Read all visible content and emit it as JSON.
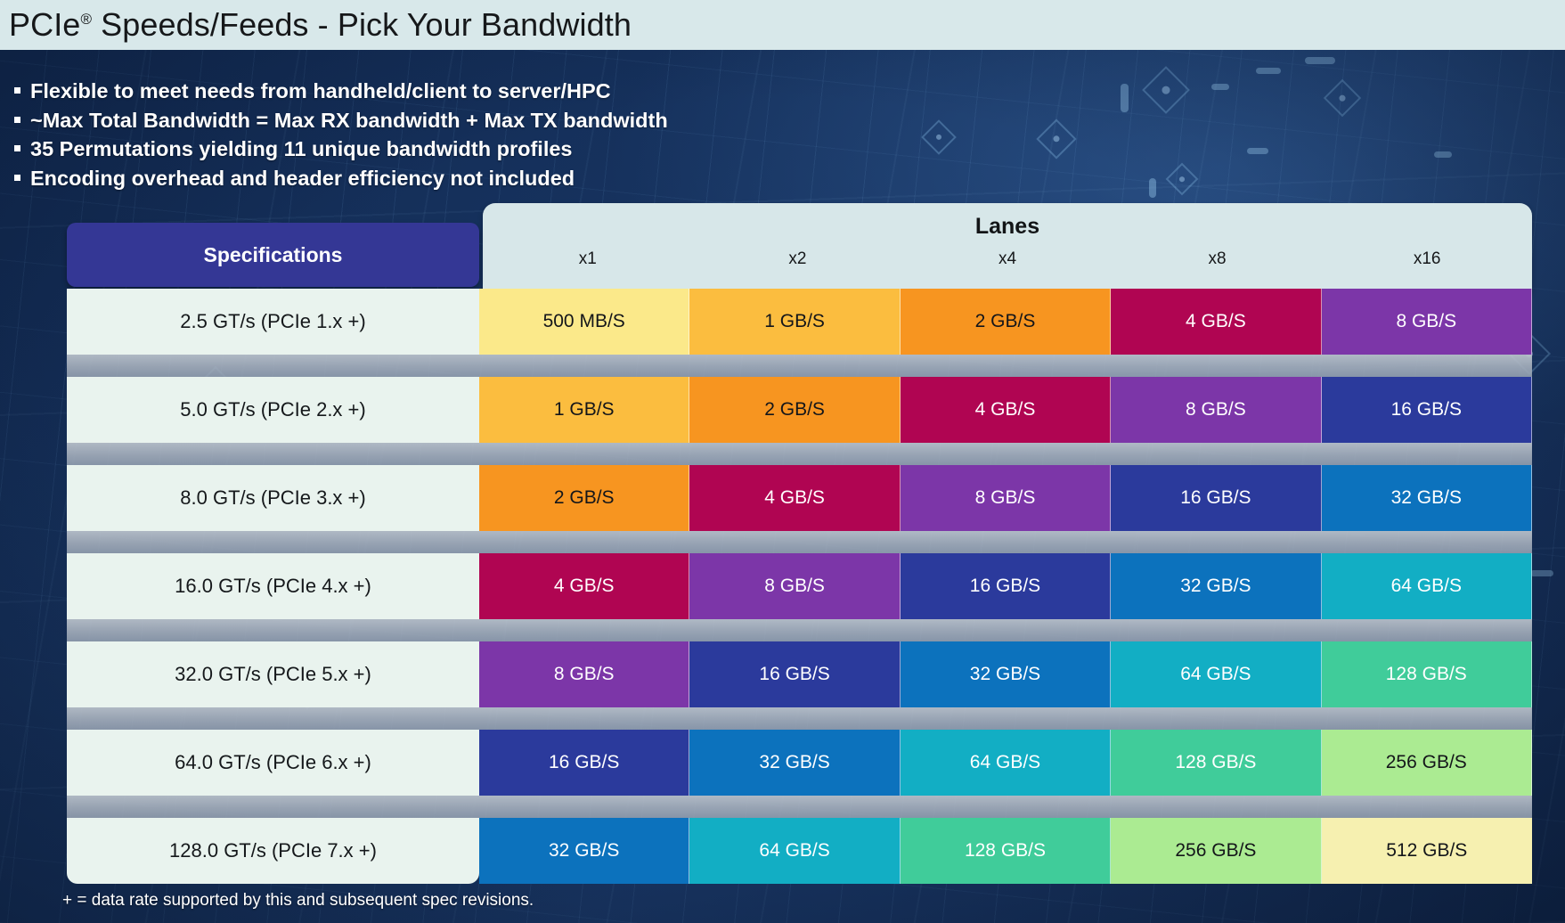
{
  "title": {
    "main": "PCIe",
    "sup": "®",
    "rest": " Speeds/Feeds - Pick Your Bandwidth",
    "full": "PCIe® Speeds/Feeds - Pick Your Bandwidth"
  },
  "bullets": [
    "Flexible to meet needs from handheld/client to server/HPC",
    "~Max Total Bandwidth = Max RX bandwidth + Max TX bandwidth",
    "35 Permutations yielding 11 unique bandwidth profiles",
    "Encoding overhead and header efficiency not included"
  ],
  "table": {
    "spec_header": "Specifications",
    "lanes_header": "Lanes",
    "lane_columns": [
      "x1",
      "x2",
      "x4",
      "x8",
      "x16"
    ],
    "rows": [
      {
        "spec": "2.5 GT/s (PCIe 1.x +)",
        "values": [
          "500 MB/S",
          "1 GB/S",
          "2 GB/S",
          "4 GB/S",
          "8 GB/S"
        ],
        "colors": [
          "#fbe98a",
          "#fbbd3f",
          "#f79520",
          "#b00552",
          "#7c36a8"
        ],
        "text_colors": [
          "dark",
          "dark",
          "dark",
          "light",
          "light"
        ]
      },
      {
        "spec": "5.0 GT/s (PCIe 2.x +)",
        "values": [
          "1 GB/S",
          "2 GB/S",
          "4 GB/S",
          "8 GB/S",
          "16 GB/S"
        ],
        "colors": [
          "#fbbd3f",
          "#f79520",
          "#b00552",
          "#7c36a8",
          "#2b3a9c"
        ],
        "text_colors": [
          "dark",
          "dark",
          "light",
          "light",
          "light"
        ]
      },
      {
        "spec": "8.0 GT/s (PCIe 3.x +)",
        "values": [
          "2 GB/S",
          "4 GB/S",
          "8 GB/S",
          "16 GB/S",
          "32 GB/S"
        ],
        "colors": [
          "#f79520",
          "#b00552",
          "#7c36a8",
          "#2b3a9c",
          "#0c72bd"
        ],
        "text_colors": [
          "dark",
          "light",
          "light",
          "light",
          "light"
        ]
      },
      {
        "spec": "16.0 GT/s (PCIe 4.x +)",
        "values": [
          "4 GB/S",
          "8 GB/S",
          "16 GB/S",
          "32 GB/S",
          "64 GB/S"
        ],
        "colors": [
          "#b00552",
          "#7c36a8",
          "#2b3a9c",
          "#0c72bd",
          "#12aec4"
        ],
        "text_colors": [
          "light",
          "light",
          "light",
          "light",
          "light"
        ]
      },
      {
        "spec": "32.0 GT/s (PCIe 5.x +)",
        "values": [
          "8 GB/S",
          "16 GB/S",
          "32 GB/S",
          "64 GB/S",
          "128 GB/S"
        ],
        "colors": [
          "#7c36a8",
          "#2b3a9c",
          "#0c72bd",
          "#12aec4",
          "#40cc9a"
        ],
        "text_colors": [
          "light",
          "light",
          "light",
          "light",
          "light"
        ]
      },
      {
        "spec": "64.0 GT/s (PCIe 6.x +)",
        "values": [
          "16 GB/S",
          "32 GB/S",
          "64 GB/S",
          "128 GB/S",
          "256 GB/S"
        ],
        "colors": [
          "#2b3a9c",
          "#0c72bd",
          "#12aec4",
          "#40cc9a",
          "#abeb92"
        ],
        "text_colors": [
          "light",
          "light",
          "light",
          "light",
          "dark"
        ]
      },
      {
        "spec": "128.0 GT/s (PCIe 7.x +)",
        "values": [
          "32 GB/S",
          "64 GB/S",
          "128 GB/S",
          "256 GB/S",
          "512 GB/S"
        ],
        "colors": [
          "#0c72bd",
          "#12aec4",
          "#40cc9a",
          "#abeb92",
          "#f6f0b0"
        ],
        "text_colors": [
          "light",
          "light",
          "light",
          "dark",
          "dark"
        ]
      }
    ]
  },
  "footnote": "+ = data rate supported by this and subsequent spec revisions.",
  "theme": {
    "title_bar_bg": "#d8e8ea",
    "spec_header_bg": "#343795",
    "spec_cell_bg": "#e9f3ee",
    "lanes_panel_bg": "#d7e7e9",
    "background_navy": "#16305c",
    "separator_gray": "#b9c2cb"
  }
}
